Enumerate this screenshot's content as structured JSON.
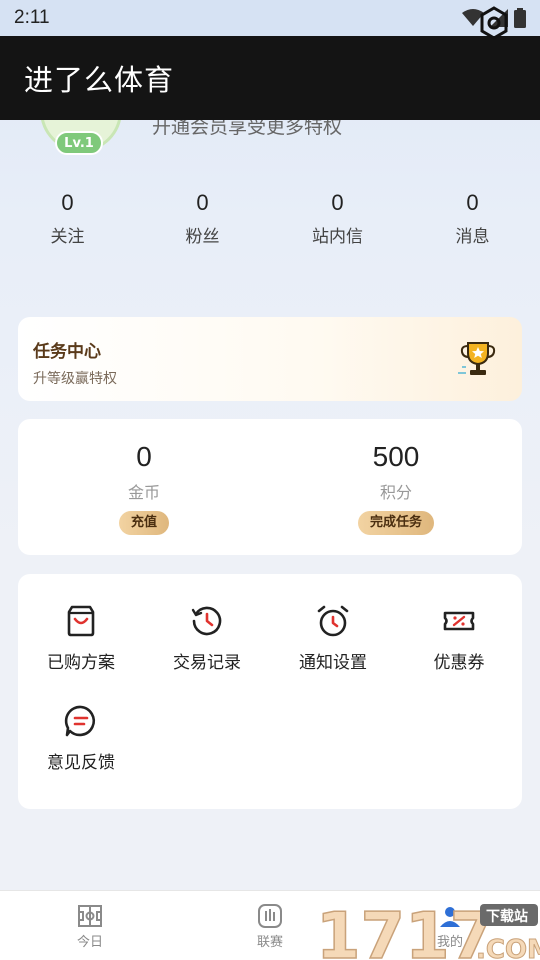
{
  "status_bar": {
    "time": "2:11"
  },
  "app": {
    "title": "进了么体育"
  },
  "profile": {
    "level": "Lv.1",
    "vip_tip": "开通会员享受更多特权"
  },
  "stats": [
    {
      "value": "0",
      "label": "关注"
    },
    {
      "value": "0",
      "label": "粉丝"
    },
    {
      "value": "0",
      "label": "站内信"
    },
    {
      "value": "0",
      "label": "消息"
    }
  ],
  "task_center": {
    "title": "任务中心",
    "subtitle": "升等级赢特权",
    "icon": "trophy-icon"
  },
  "wallet": {
    "coins": {
      "value": "0",
      "label": "金币",
      "button": "充值"
    },
    "points": {
      "value": "500",
      "label": "积分",
      "button": "完成任务"
    }
  },
  "menu": [
    {
      "label": "已购方案",
      "icon": "shopping-bag-icon"
    },
    {
      "label": "交易记录",
      "icon": "history-icon"
    },
    {
      "label": "通知设置",
      "icon": "alarm-clock-icon"
    },
    {
      "label": "优惠券",
      "icon": "coupon-icon"
    },
    {
      "label": "意见反馈",
      "icon": "feedback-icon"
    }
  ],
  "bottom_nav": [
    {
      "label": "今日",
      "icon": "field-icon"
    },
    {
      "label": "联赛",
      "icon": "league-icon"
    },
    {
      "label": "我的",
      "icon": "profile-icon"
    }
  ],
  "watermark": {
    "digits": "1717",
    "site": "下载站",
    "domain": ".COM"
  },
  "colors": {
    "accent_gold": "#dfb77d",
    "menu_icon_red": "#e0332f",
    "title_bar": "#141414",
    "level_green": "#7fc97b"
  }
}
